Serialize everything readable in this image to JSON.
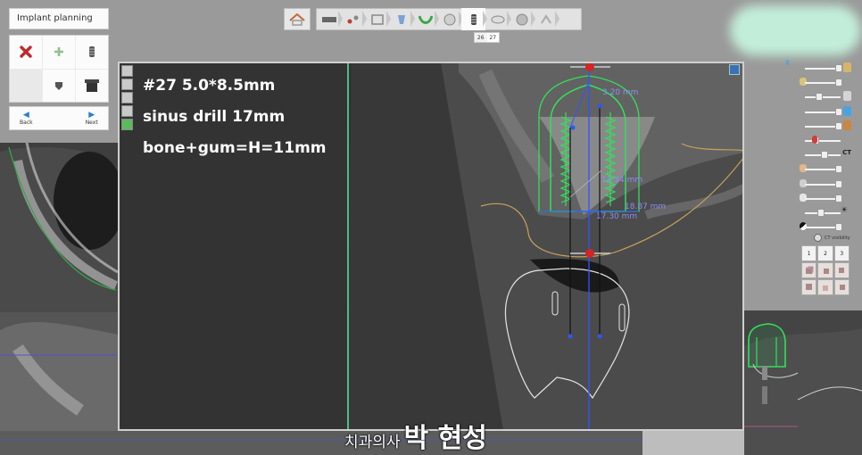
{
  "left_panel": {
    "title": "Implant planning",
    "back_label": "Back",
    "next_label": "Next"
  },
  "toolbar": {
    "tooth_numbers": [
      "26",
      "27"
    ]
  },
  "viewer": {
    "notes": [
      "#27 5.0*8.5mm",
      "sinus drill 17mm",
      "bone+gum=H=11mm"
    ],
    "measurements": {
      "m1": "3.20 mm",
      "m2": "11.34 mm",
      "m3": "18.87 mm",
      "m4": "17.30 mm"
    }
  },
  "right_panel": {
    "ct_visibility_label": "CT visibility",
    "view_buttons": [
      "1",
      "2",
      "3"
    ],
    "ct_label": "CT"
  },
  "watermark": {
    "prefix": "치과의사",
    "name": "박 현성"
  },
  "colors": {
    "implant_green": "#33e05a",
    "guide_blue": "#2f55ff",
    "nerve_tan": "#c9a25a",
    "divider": "#5fe3a8"
  }
}
